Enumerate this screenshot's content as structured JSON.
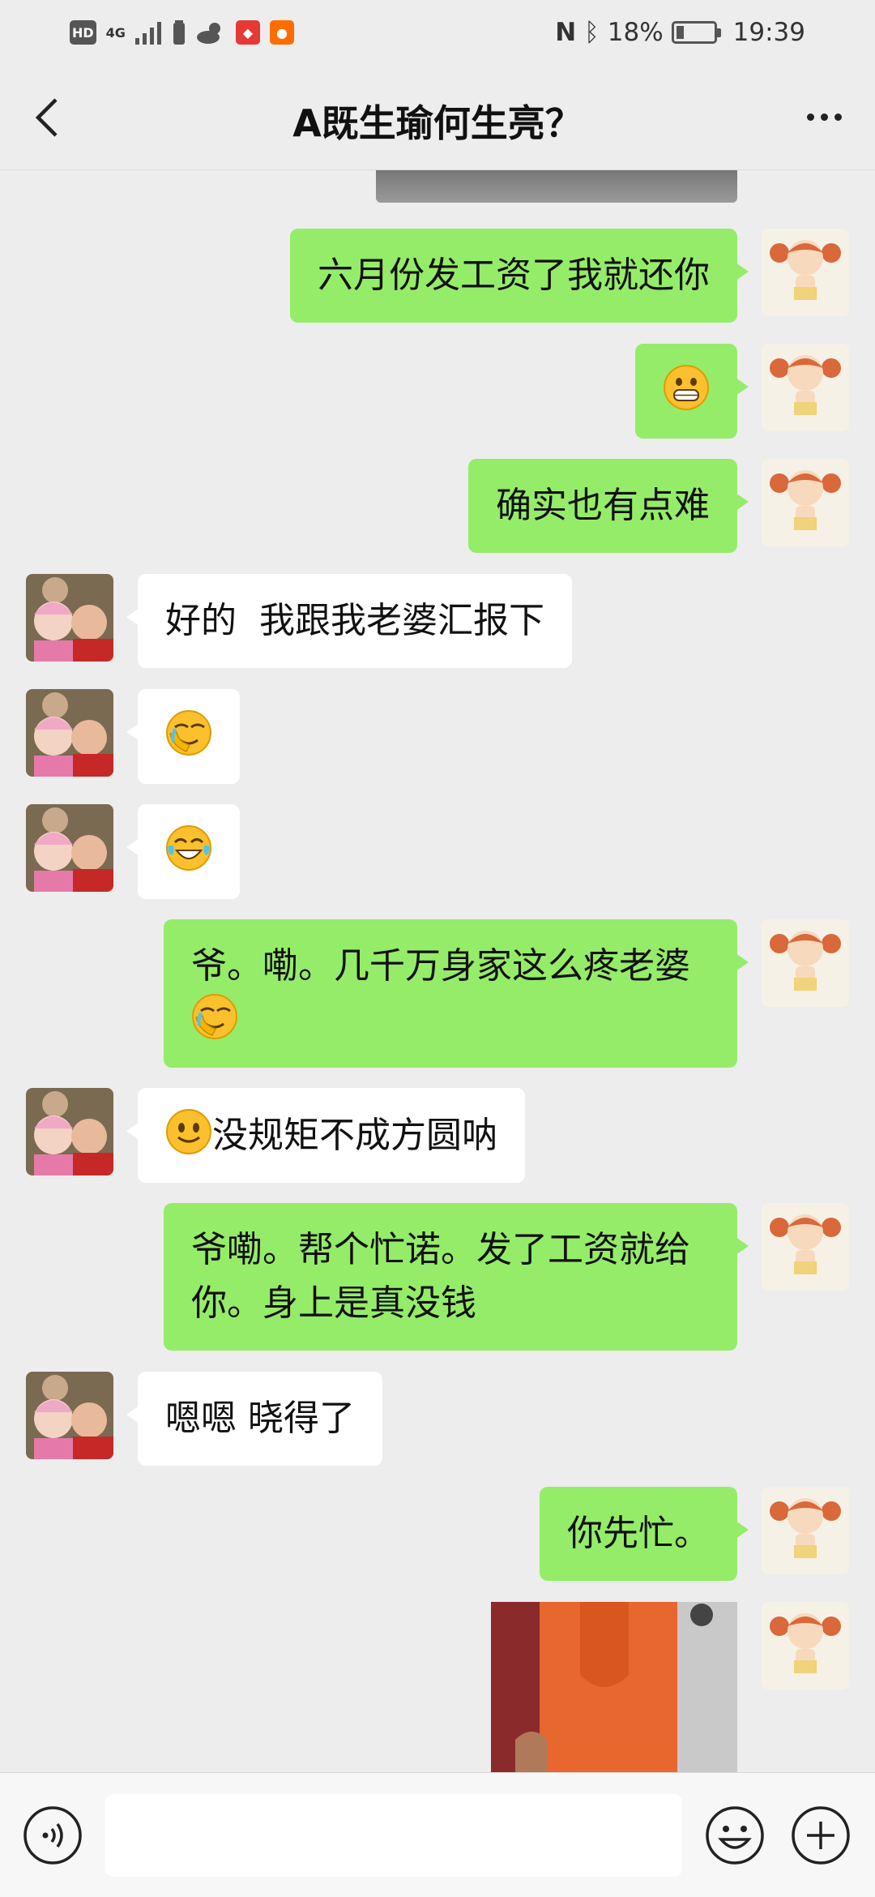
{
  "status_bar": {
    "hd": "HD",
    "network": "4G",
    "battery_percent": "18%",
    "time": "19:39",
    "battery_level": 0.18
  },
  "header": {
    "title": "A既生瑜何生亮？"
  },
  "messages": [
    {
      "side": "right",
      "text": "六月份发工资了我就还你"
    },
    {
      "side": "right",
      "emoji": "grin-icon"
    },
    {
      "side": "right",
      "text": "确实也有点难"
    },
    {
      "side": "left",
      "text": "好的  我跟我老婆汇报下"
    },
    {
      "side": "left",
      "emoji": "facepalm-icon"
    },
    {
      "side": "left",
      "emoji": "tears-of-joy-icon"
    },
    {
      "side": "right",
      "text_line1": "爷。嘞。几千万身家这么疼老婆",
      "emoji": "facepalm-icon"
    },
    {
      "side": "left",
      "emoji": "smile-icon",
      "text": "没规矩不成方圆呐"
    },
    {
      "side": "right",
      "text_line1": "爷嘞。帮个忙诺。发了工资就给",
      "text_line2": "你。身上是真没钱"
    },
    {
      "side": "left",
      "text": "嗯嗯 晓得了"
    },
    {
      "side": "right",
      "text": "你先忙。"
    },
    {
      "side": "right",
      "image": "photo"
    }
  ],
  "input_bar": {
    "placeholder": ""
  },
  "colors": {
    "background": "#ededed",
    "right_bubble": "#95ec69",
    "left_bubble": "#ffffff"
  }
}
